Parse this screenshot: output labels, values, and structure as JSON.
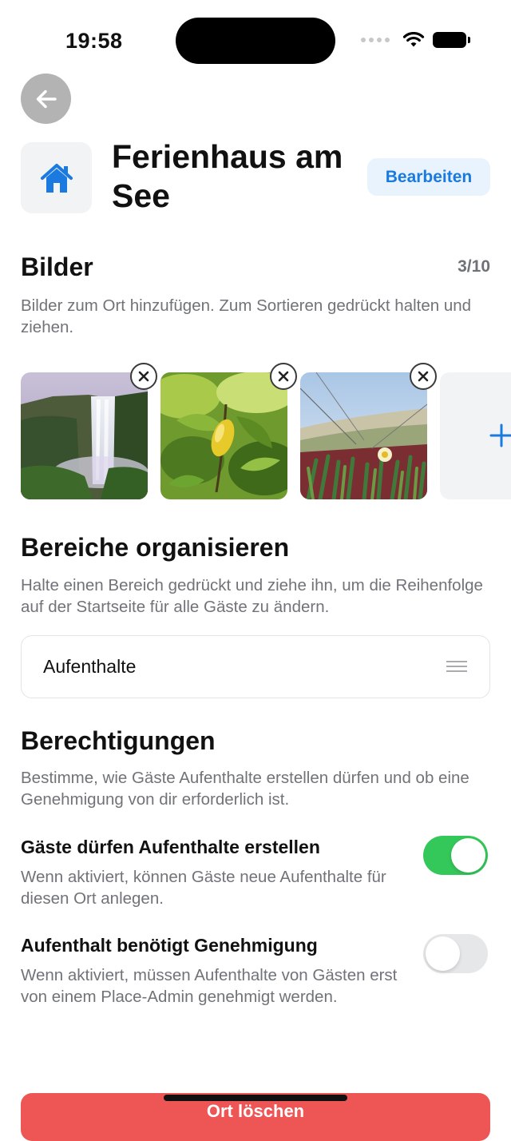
{
  "status_bar": {
    "time": "19:58"
  },
  "header": {
    "title": "Ferienhaus am See",
    "edit_label": "Bearbeiten",
    "place_icon": "house-icon"
  },
  "images": {
    "title": "Bilder",
    "count": "3/10",
    "description": "Bilder zum Ort hinzufügen. Zum Sortieren gedrückt halten und ziehen.",
    "items": [
      {
        "subject": "waterfall"
      },
      {
        "subject": "lemon tree"
      },
      {
        "subject": "coastal flower"
      }
    ]
  },
  "areas": {
    "title": "Bereiche organisieren",
    "description": "Halte einen Bereich gedrückt und ziehe ihn, um die Reihenfolge auf der Startseite für alle Gäste zu ändern.",
    "items": [
      {
        "label": "Aufenthalte"
      }
    ]
  },
  "permissions": {
    "title": "Berechtigungen",
    "description": "Bestimme, wie Gäste Aufenthalte erstellen dürfen und ob eine Genehmigung von dir erforderlich ist.",
    "toggles": [
      {
        "title": "Gäste dürfen Aufenthalte erstellen",
        "description": "Wenn aktiviert, können Gäste neue Aufenthalte für diesen Ort anlegen.",
        "on": true
      },
      {
        "title": "Aufenthalt benötigt Genehmigung",
        "description": "Wenn aktiviert, müssen Aufenthalte von Gästen erst von einem Place-Admin genehmigt werden.",
        "on": false
      }
    ]
  },
  "footer": {
    "danger_label": "Ort löschen"
  },
  "colors": {
    "accent": "#1a7ae0",
    "toggle_on": "#34c759",
    "danger": "#ee5555",
    "secondary_text": "#707378"
  }
}
